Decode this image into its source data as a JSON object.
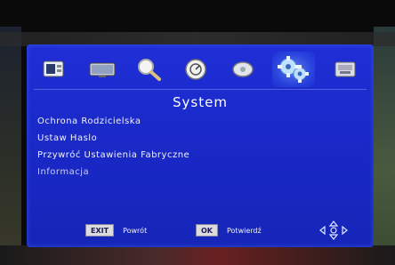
{
  "menu_tabs": [
    {
      "name": "tv-channel-tab"
    },
    {
      "name": "picture-tab"
    },
    {
      "name": "search-tab"
    },
    {
      "name": "time-tab"
    },
    {
      "name": "options-tab"
    },
    {
      "name": "system-tab",
      "active": true
    },
    {
      "name": "usb-tab"
    }
  ],
  "screen": {
    "title": "System"
  },
  "menu": {
    "items": [
      "Ochrona Rodzicielska",
      "Ustaw Haslo",
      "Przywróć Ustawienia Fabryczne",
      "Informacja"
    ]
  },
  "help": {
    "exit_key": "EXIT",
    "exit_label": "Powrót",
    "ok_key": "OK",
    "ok_label": "Potwierdź"
  },
  "colors": {
    "panel": "#1f2fd6",
    "text": "#ffffff"
  }
}
